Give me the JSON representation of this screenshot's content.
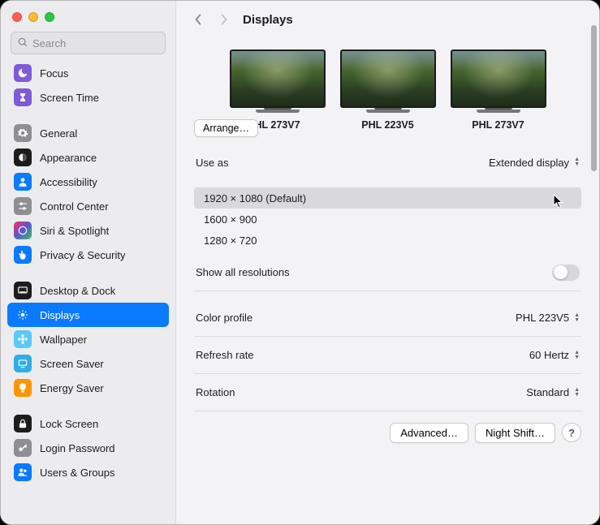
{
  "header": {
    "title": "Displays"
  },
  "search": {
    "placeholder": "Search"
  },
  "sidebar": {
    "groups": [
      [
        {
          "id": "focus",
          "label": "Focus",
          "icon": "moon",
          "bg": "bg-purple"
        },
        {
          "id": "screentime",
          "label": "Screen Time",
          "icon": "hourglass",
          "bg": "bg-purple"
        }
      ],
      [
        {
          "id": "general",
          "label": "General",
          "icon": "gear",
          "bg": "bg-gray"
        },
        {
          "id": "appearance",
          "label": "Appearance",
          "icon": "appearance",
          "bg": "bg-black"
        },
        {
          "id": "accessibility",
          "label": "Accessibility",
          "icon": "person",
          "bg": "bg-blue"
        },
        {
          "id": "controlcenter",
          "label": "Control Center",
          "icon": "sliders",
          "bg": "bg-gray"
        },
        {
          "id": "siri",
          "label": "Siri & Spotlight",
          "icon": "siri",
          "bg": "bg-multicolor"
        },
        {
          "id": "privacy",
          "label": "Privacy & Security",
          "icon": "hand",
          "bg": "bg-blue"
        }
      ],
      [
        {
          "id": "desktopdock",
          "label": "Desktop & Dock",
          "icon": "dock",
          "bg": "bg-black"
        },
        {
          "id": "displays",
          "label": "Displays",
          "icon": "sun",
          "bg": "bg-blue",
          "active": true
        },
        {
          "id": "wallpaper",
          "label": "Wallpaper",
          "icon": "flower",
          "bg": "bg-skyblue"
        },
        {
          "id": "screensaver",
          "label": "Screen Saver",
          "icon": "scr",
          "bg": "bg-cyan"
        },
        {
          "id": "energysaver",
          "label": "Energy Saver",
          "icon": "bulb",
          "bg": "bg-orange"
        }
      ],
      [
        {
          "id": "lockscreen",
          "label": "Lock Screen",
          "icon": "lock",
          "bg": "bg-black"
        },
        {
          "id": "loginpassword",
          "label": "Login Password",
          "icon": "key",
          "bg": "bg-gray"
        },
        {
          "id": "usersgroups",
          "label": "Users & Groups",
          "icon": "users",
          "bg": "bg-blue"
        }
      ]
    ]
  },
  "arrange_label": "Arrange…",
  "monitors": [
    {
      "label": "HL 273V7",
      "clipped_full": "PHL 273V7"
    },
    {
      "label": "PHL 223V5",
      "selected": true
    },
    {
      "label": "PHL 273V7"
    }
  ],
  "settings": {
    "use_as": {
      "label": "Use as",
      "value": "Extended display"
    },
    "resolutions": [
      {
        "label": "1920 × 1080 (Default)",
        "selected": true
      },
      {
        "label": "1600 × 900"
      },
      {
        "label": "1280 × 720"
      }
    ],
    "show_all": {
      "label": "Show all resolutions",
      "on": false
    },
    "color_profile": {
      "label": "Color profile",
      "value": "PHL 223V5"
    },
    "refresh_rate": {
      "label": "Refresh rate",
      "value": "60 Hertz"
    },
    "rotation": {
      "label": "Rotation",
      "value": "Standard"
    }
  },
  "buttons": {
    "advanced": "Advanced…",
    "night_shift": "Night Shift…",
    "help": "?"
  }
}
